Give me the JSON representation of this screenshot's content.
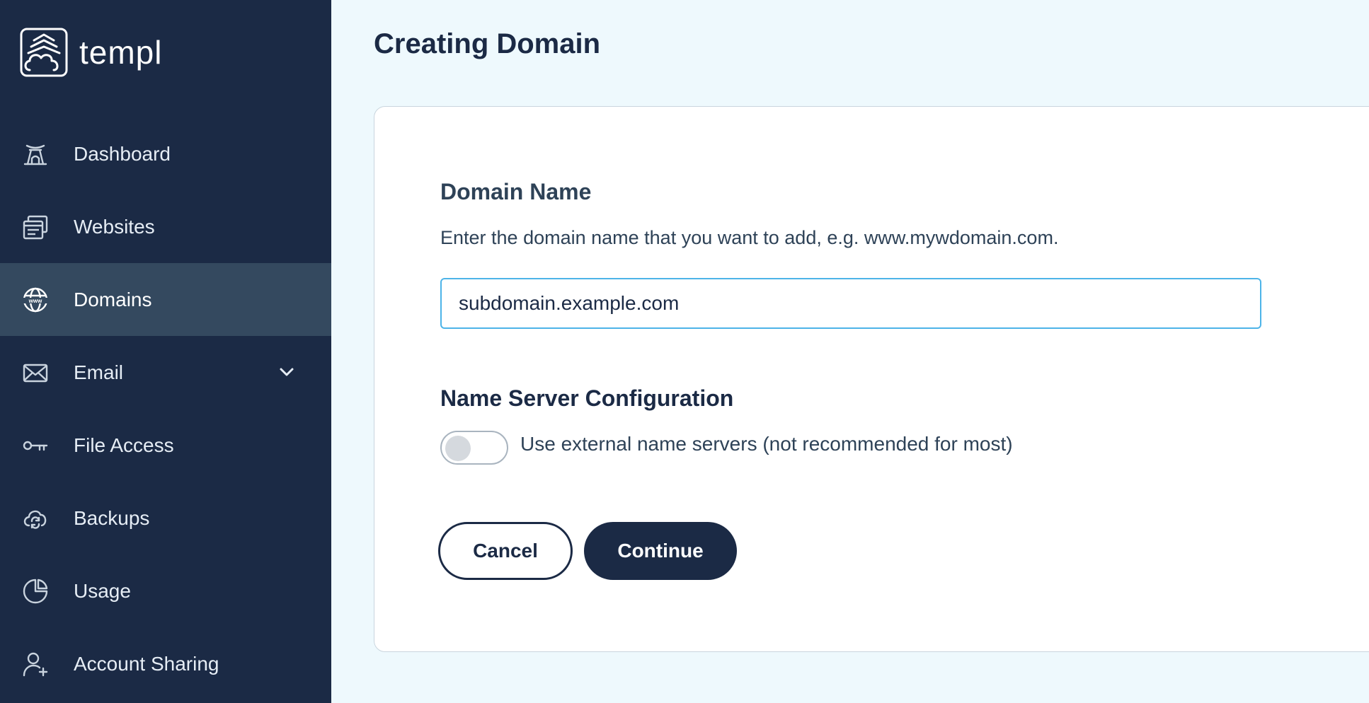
{
  "brand": {
    "name": "templ"
  },
  "sidebar": {
    "items": [
      {
        "label": "Dashboard",
        "icon": "dashboard-icon"
      },
      {
        "label": "Websites",
        "icon": "websites-icon"
      },
      {
        "label": "Domains",
        "icon": "www-globe-icon",
        "active": true
      },
      {
        "label": "Email",
        "icon": "email-icon",
        "expandable": true
      },
      {
        "label": "File Access",
        "icon": "key-icon"
      },
      {
        "label": "Backups",
        "icon": "cloud-sync-icon"
      },
      {
        "label": "Usage",
        "icon": "pie-chart-icon"
      },
      {
        "label": "Account Sharing",
        "icon": "add-user-icon"
      }
    ]
  },
  "page": {
    "title": "Creating Domain"
  },
  "form": {
    "domain_title": "Domain Name",
    "domain_help": "Enter the domain name that you want to add, e.g. www.mywdomain.com.",
    "domain_value": "subdomain.example.com",
    "ns_title": "Name Server Configuration",
    "ns_toggle_label": "Use external name servers (not recommended for most)",
    "ns_toggle_on": false,
    "cancel_label": "Cancel",
    "continue_label": "Continue"
  },
  "colors": {
    "sidebar_bg": "#1b2a45",
    "sidebar_active": "#34495f",
    "page_bg": "#eef9fd",
    "input_border": "#4db4e8",
    "primary": "#1b2a45"
  }
}
